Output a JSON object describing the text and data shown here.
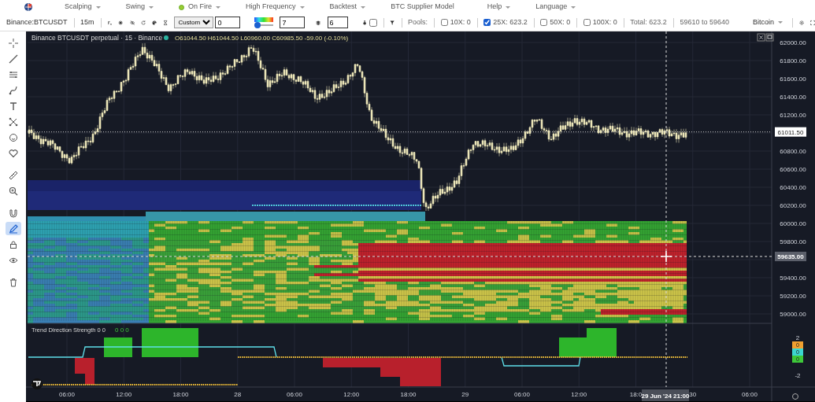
{
  "menu": [
    {
      "label": "Scalping",
      "kind": "dropdown"
    },
    {
      "label": "Swing",
      "kind": "dropdown"
    },
    {
      "label": "On Fire",
      "kind": "status-dropdown"
    },
    {
      "label": "High Frequency",
      "kind": "dropdown"
    },
    {
      "label": "Backtest",
      "kind": "dropdown"
    },
    {
      "label": "BTC Supplier Model",
      "kind": "plain"
    },
    {
      "label": "Help",
      "kind": "dropdown"
    },
    {
      "label": "Language",
      "kind": "dropdown"
    }
  ],
  "toolbar": {
    "symbol": "Binance:BTCUSDT",
    "interval": "15m",
    "range_mode": "Custom",
    "range_value": "0",
    "gradient_slider": {
      "level": 0
    },
    "gradient_value": "7",
    "layers_value": "6",
    "toggle_checked": false,
    "pools_label": "Pools:",
    "pools": [
      {
        "label": "10X: 0",
        "checked": false
      },
      {
        "label": "25X: 623.2",
        "checked": true
      },
      {
        "label": "50X: 0",
        "checked": false
      },
      {
        "label": "100X: 0",
        "checked": false
      }
    ],
    "total": "Total: 623.2",
    "price_range": "59610 to 59640",
    "asset": "Bitcoin"
  },
  "left_tools": [
    {
      "kind": "crosshair",
      "selected": false
    },
    {
      "kind": "trendline",
      "selected": false
    },
    {
      "kind": "multiline",
      "selected": false
    },
    {
      "kind": "brush",
      "selected": false
    },
    {
      "kind": "text",
      "selected": false
    },
    {
      "kind": "nodes",
      "selected": false
    },
    {
      "kind": "smiley",
      "selected": false
    },
    {
      "kind": "heart",
      "selected": false
    },
    {
      "kind": "ruler",
      "selected": false
    },
    {
      "kind": "zoom",
      "selected": false
    },
    {
      "kind": "magnet",
      "selected": false
    },
    {
      "kind": "pencil",
      "selected": true
    },
    {
      "kind": "lock",
      "selected": false
    },
    {
      "kind": "eye",
      "selected": false
    },
    {
      "kind": "trash",
      "selected": false
    }
  ],
  "chart": {
    "title": "Binance BTCUSDT perpetual · 15 · Binance",
    "ohlc": "O61044.50 H61044.50 L60960.00 C60985.50 -59.00 (-0.10%)",
    "price_labels": [
      "62000.00",
      "61800.00",
      "61600.00",
      "61400.00",
      "61200.00",
      "60800.00",
      "60600.00",
      "60400.00",
      "60200.00",
      "60000.00",
      "59800.00",
      "59400.00",
      "59200.00",
      "59000.00"
    ],
    "last_price": "61011.50",
    "crosshair_price": "59635.00",
    "time_labels": [
      "06:00",
      "12:00",
      "18:00",
      "28",
      "06:00",
      "12:00",
      "18:00",
      "29",
      "06:00",
      "12:00",
      "18:0",
      "30",
      "06:00"
    ],
    "crosshair_time": "29 Jun '24  21:00"
  },
  "indicator": {
    "title": "Trend Direction Strength 0 0",
    "values": "0 0 0",
    "scale": [
      "2",
      "-2"
    ],
    "legend": [
      {
        "label": "0",
        "color": "#f0a030"
      },
      {
        "label": "0",
        "color": "#3cd6d0"
      },
      {
        "label": "0",
        "color": "#3ec83a"
      }
    ]
  }
}
